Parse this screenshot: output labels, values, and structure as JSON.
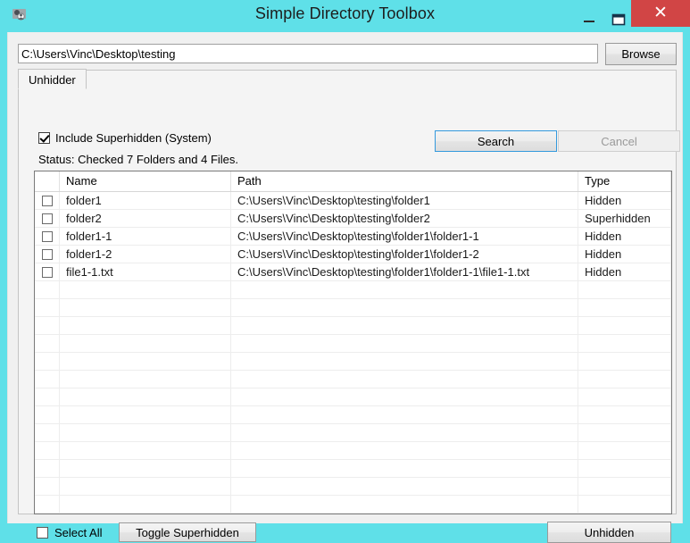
{
  "window": {
    "title": "Simple Directory Toolbox",
    "app_icon": "people-icon",
    "accent_color": "#5fe0e8",
    "close_color": "#d14545",
    "controls": {
      "minimize": "–",
      "maximize": "❐",
      "close": "✕"
    }
  },
  "path_bar": {
    "value": "C:\\Users\\Vinc\\Desktop\\testing",
    "placeholder": "",
    "browse_label": "Browse"
  },
  "tabs": [
    {
      "label": "Unhidder",
      "selected": true
    }
  ],
  "options": {
    "include_superhidden_label": "Include Superhidden (System)",
    "include_superhidden_checked": true,
    "status_text": "Status: Checked 7 Folders and 4 Files."
  },
  "actions": {
    "search_label": "Search",
    "cancel_label": "Cancel",
    "cancel_disabled": true,
    "search_focused": true
  },
  "list": {
    "columns": [
      "",
      "Name",
      "Path",
      "Type"
    ],
    "rows": [
      {
        "checked": false,
        "name": "folder1",
        "path": "C:\\Users\\Vinc\\Desktop\\testing\\folder1",
        "type": "Hidden"
      },
      {
        "checked": false,
        "name": "folder2",
        "path": "C:\\Users\\Vinc\\Desktop\\testing\\folder2",
        "type": "Superhidden"
      },
      {
        "checked": false,
        "name": "folder1-1",
        "path": "C:\\Users\\Vinc\\Desktop\\testing\\folder1\\folder1-1",
        "type": "Hidden"
      },
      {
        "checked": false,
        "name": "folder1-2",
        "path": "C:\\Users\\Vinc\\Desktop\\testing\\folder1\\folder1-2",
        "type": "Hidden"
      },
      {
        "checked": false,
        "name": "file1-1.txt",
        "path": "C:\\Users\\Vinc\\Desktop\\testing\\folder1\\folder1-1\\file1-1.txt",
        "type": "Hidden"
      }
    ],
    "empty_row_count": 13
  },
  "footer": {
    "select_all_label": "Select All",
    "select_all_checked": false,
    "toggle_superhidden_label": "Toggle Superhidden",
    "unhidden_label": "Unhidden"
  }
}
